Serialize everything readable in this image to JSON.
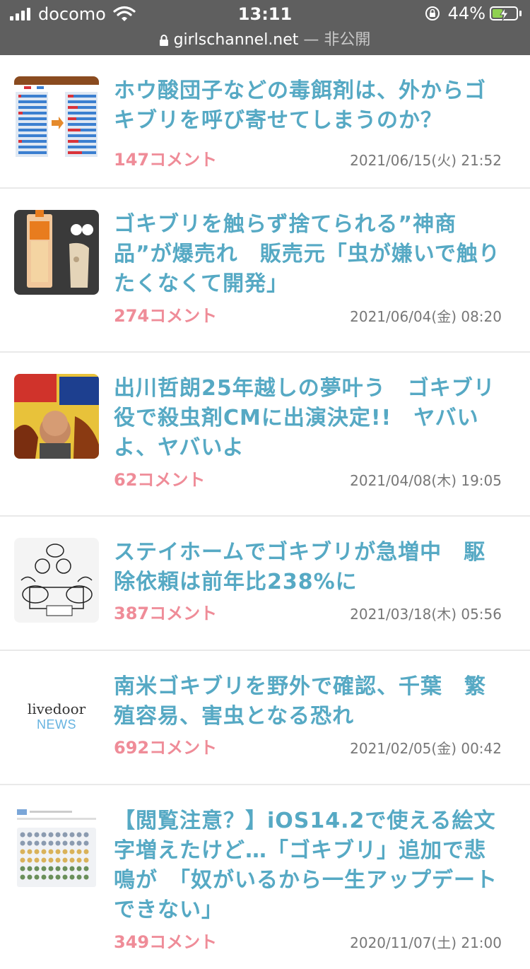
{
  "status_bar": {
    "carrier": "docomo",
    "time": "13:11",
    "battery_percent": "44%",
    "battery_level": 0.44,
    "charging": true,
    "icons": [
      "signal-icon",
      "wifi-icon",
      "rotation-lock-icon",
      "battery-icon"
    ]
  },
  "url_bar": {
    "domain": "girlschannel.net",
    "separator": " — ",
    "mode": "非公開"
  },
  "colors": {
    "title": "#56a9c4",
    "comments": "#ef8c98",
    "date": "#777777",
    "statusbar_bg": "#5f5f5f"
  },
  "articles": [
    {
      "title": "ホウ酸団子などの毒餌剤は、外からゴキブリを呼び寄せてしまうのか？",
      "comments": "147コメント",
      "date": "2021/06/15(火) 21:52",
      "thumb": "survey-bar-chart-thumbnail"
    },
    {
      "title": "ゴキブリを触らず捨てられる”神商品”が爆売れ　販売元「虫が嫌いで触りたくなくて開発」",
      "comments": "274コメント",
      "date": "2021/06/04(金) 08:20",
      "thumb": "product-photo-thumbnail"
    },
    {
      "title": "出川哲朗25年越しの夢叶う　ゴキブリ役で殺虫剤CMに出演決定!!　ヤバいよ、ヤバいよ",
      "comments": "62コメント",
      "date": "2021/04/08(木) 19:05",
      "thumb": "commercial-poster-thumbnail"
    },
    {
      "title": "ステイホームでゴキブリが急増中　駆除依頼は前年比238%に",
      "comments": "387コメント",
      "date": "2021/03/18(木) 05:56",
      "thumb": "manga-illustration-thumbnail"
    },
    {
      "title": "南米ゴキブリを野外で確認、千葉　繁殖容易、害虫となる恐れ",
      "comments": "692コメント",
      "date": "2021/02/05(金) 00:42",
      "thumb_logo_top": "livedoor",
      "thumb_logo_bottom": "NEWS"
    },
    {
      "title": "【閲覧注意？】iOS14.2で使える絵文字増えたけど…「ゴキブリ」追加で悲鳴が　「奴がいるから一生アップデートできない」",
      "comments": "349コメント",
      "date": "2020/11/07(土) 21:00",
      "thumb": "emoji-grid-thumbnail"
    }
  ]
}
